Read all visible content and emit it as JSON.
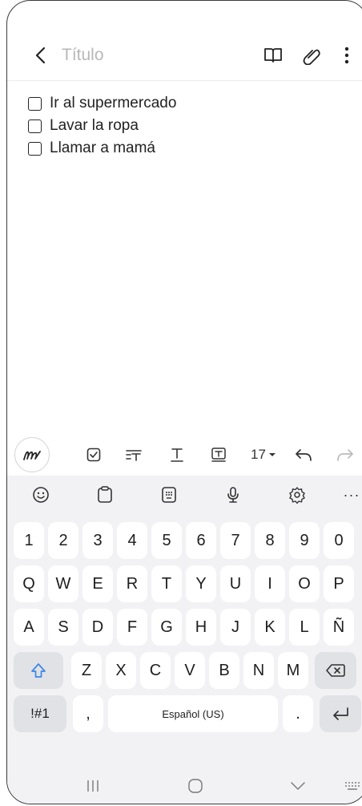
{
  "note": {
    "title_placeholder": "Título",
    "items": [
      {
        "text": "Ir al supermercado",
        "checked": false
      },
      {
        "text": "Lavar la ropa",
        "checked": false
      },
      {
        "text": "Llamar a mamá",
        "checked": false
      }
    ]
  },
  "toolbar": {
    "font_size": "17",
    "icons": [
      "handwriting-icon",
      "checkbox-icon",
      "paragraph-style-icon",
      "text-style-icon",
      "text-box-icon",
      "font-size-dropdown",
      "undo-icon",
      "redo-icon"
    ]
  },
  "keyboard": {
    "tools": [
      "emoji-icon",
      "clipboard-icon",
      "keypad-icon",
      "microphone-icon",
      "settings-icon",
      "more-icon"
    ],
    "more_label": "···",
    "number_row": [
      "1",
      "2",
      "3",
      "4",
      "5",
      "6",
      "7",
      "8",
      "9",
      "0"
    ],
    "row1": [
      "Q",
      "W",
      "E",
      "R",
      "T",
      "Y",
      "U",
      "I",
      "O",
      "P"
    ],
    "row2": [
      "A",
      "S",
      "D",
      "F",
      "G",
      "H",
      "J",
      "K",
      "L",
      "Ñ"
    ],
    "row3": [
      "Z",
      "X",
      "C",
      "V",
      "B",
      "N",
      "M"
    ],
    "symbols_label": "!#1",
    "comma_label": ",",
    "space_label": "Español (US)",
    "period_label": "."
  },
  "accent_color": "#3b86e8"
}
